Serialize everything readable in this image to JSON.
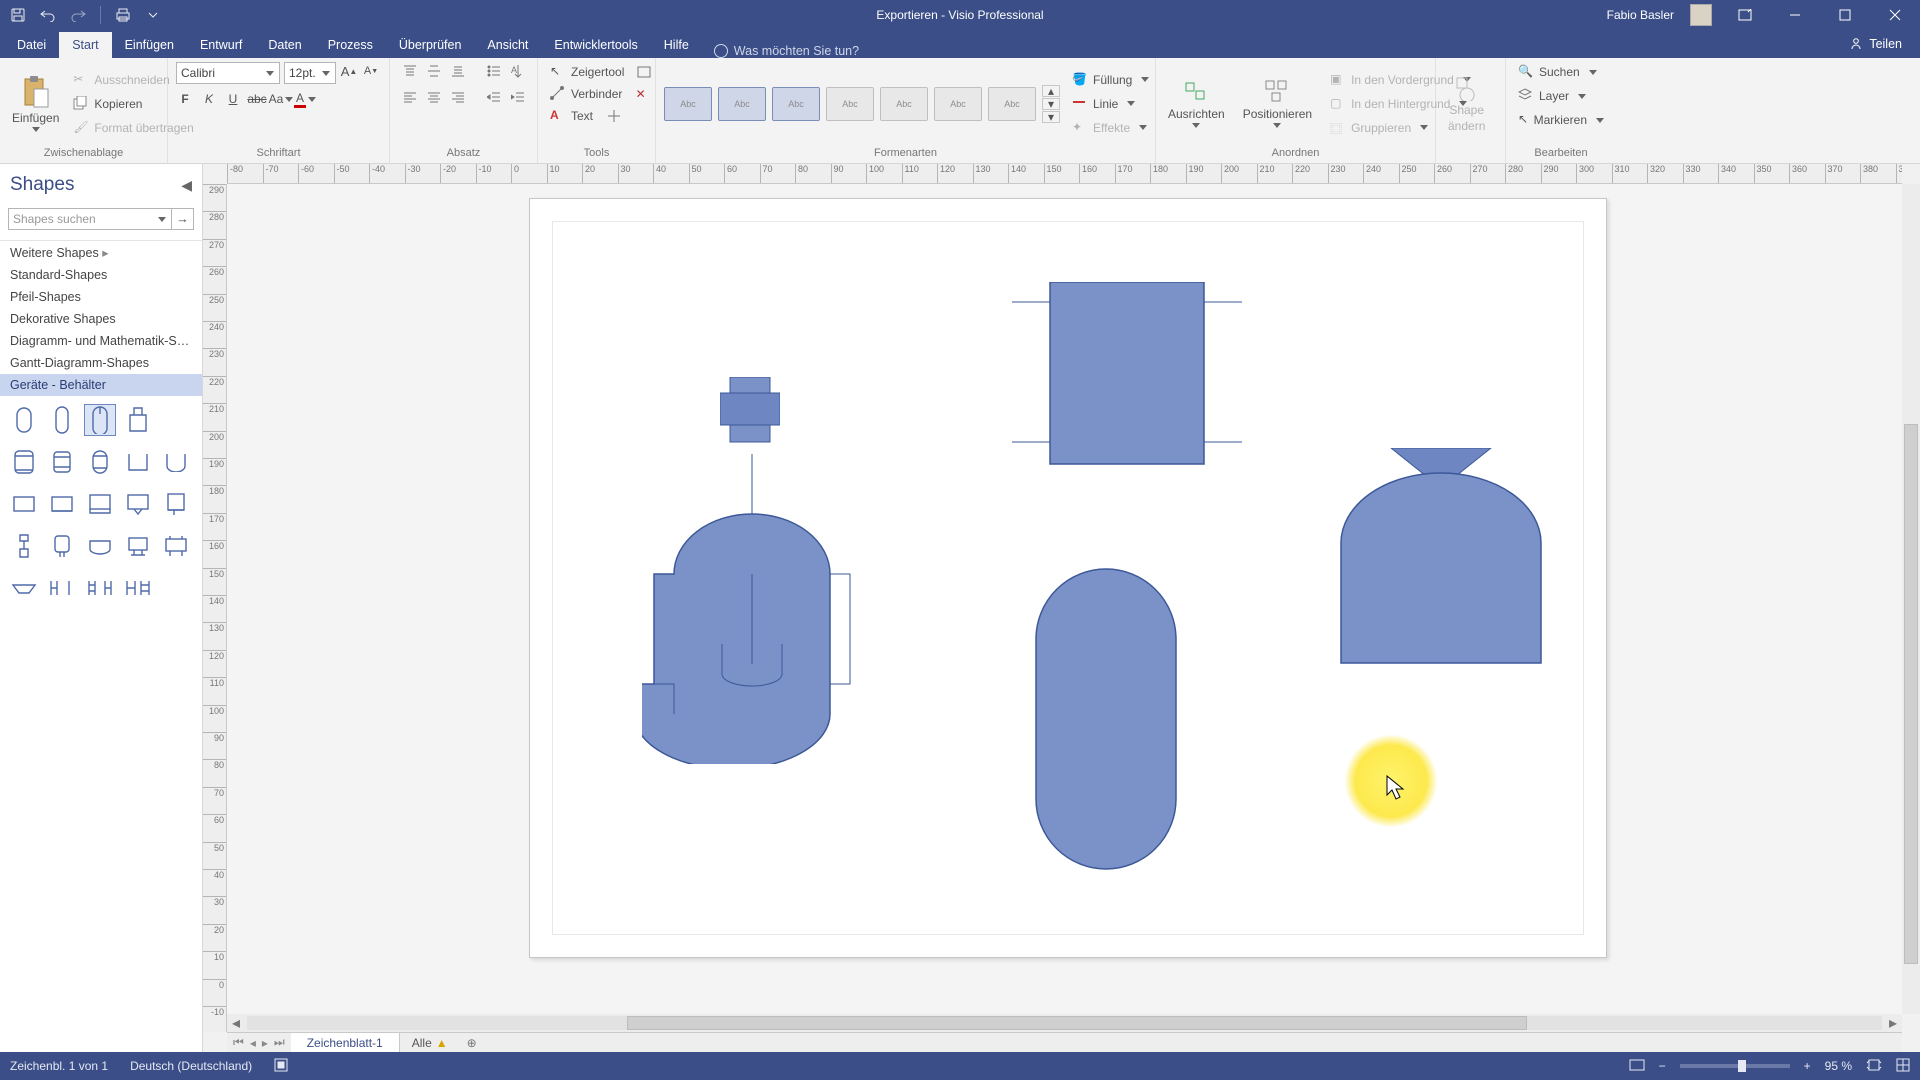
{
  "app": {
    "title": "Exportieren  -  Visio Professional",
    "user": "Fabio Basler"
  },
  "ribbon": {
    "tabs": [
      "Datei",
      "Start",
      "Einfügen",
      "Entwurf",
      "Daten",
      "Prozess",
      "Überprüfen",
      "Ansicht",
      "Entwicklertools",
      "Hilfe"
    ],
    "active_tab": "Start",
    "tellme": "Was möchten Sie tun?",
    "share": "Teilen",
    "groups": {
      "clipboard": {
        "label": "Zwischenablage",
        "paste": "Einfügen",
        "cut": "Ausschneiden",
        "copy": "Kopieren",
        "format_painter": "Format übertragen"
      },
      "font": {
        "label": "Schriftart",
        "name": "Calibri",
        "size": "12pt."
      },
      "paragraph": {
        "label": "Absatz"
      },
      "tools": {
        "label": "Tools",
        "pointer": "Zeigertool",
        "connector": "Verbinder",
        "text": "Text"
      },
      "styles": {
        "label": "Formenarten",
        "thumb_text": "Abc"
      },
      "shapefill": {
        "fill": "Füllung",
        "line": "Linie",
        "effects": "Effekte"
      },
      "arrange": {
        "label": "Anordnen",
        "align": "Ausrichten",
        "position": "Positionieren",
        "front": "In den Vordergrund",
        "back": "In den Hintergrund",
        "group": "Gruppieren"
      },
      "shapechange": {
        "label1": "Shape",
        "label2": "ändern"
      },
      "editing": {
        "label": "Bearbeiten",
        "find": "Suchen",
        "layer": "Layer",
        "select": "Markieren"
      }
    }
  },
  "shapes_pane": {
    "title": "Shapes",
    "search_placeholder": "Shapes suchen",
    "categories": [
      "Weitere Shapes",
      "Standard-Shapes",
      "Pfeil-Shapes",
      "Dekorative Shapes",
      "Diagramm- und Mathematik-Sh...",
      "Gantt-Diagramm-Shapes",
      "Geräte - Behälter"
    ],
    "selected_category": "Geräte - Behälter"
  },
  "page_tabs": {
    "sheet": "Zeichenblatt-1",
    "all": "Alle"
  },
  "statusbar": {
    "page_info": "Zeichenbl. 1 von 1",
    "language": "Deutsch (Deutschland)",
    "zoom": "95 %"
  },
  "ruler": {
    "h_start": -80,
    "h_step": 10,
    "h_count": 48,
    "v_start": 290,
    "v_step": -10,
    "v_count": 31
  }
}
